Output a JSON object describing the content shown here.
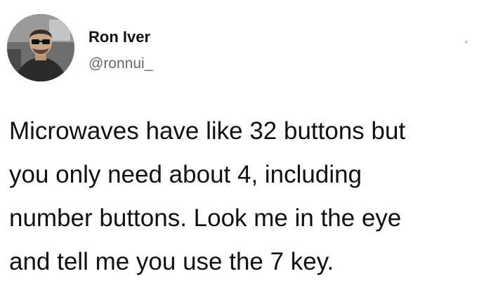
{
  "tweet": {
    "author": {
      "display_name": "Ron Iver",
      "handle": "@ronnui_",
      "avatar_icon": "profile-photo-man-sunglasses"
    },
    "body_lines": [
      "Microwaves have like 32 buttons but",
      "you only need about 4, including",
      "number buttons. Look me in the eye",
      "and tell me you use the 7 key."
    ]
  },
  "colors": {
    "background": "#ffffff",
    "text": "#111111",
    "handle": "#666666"
  }
}
